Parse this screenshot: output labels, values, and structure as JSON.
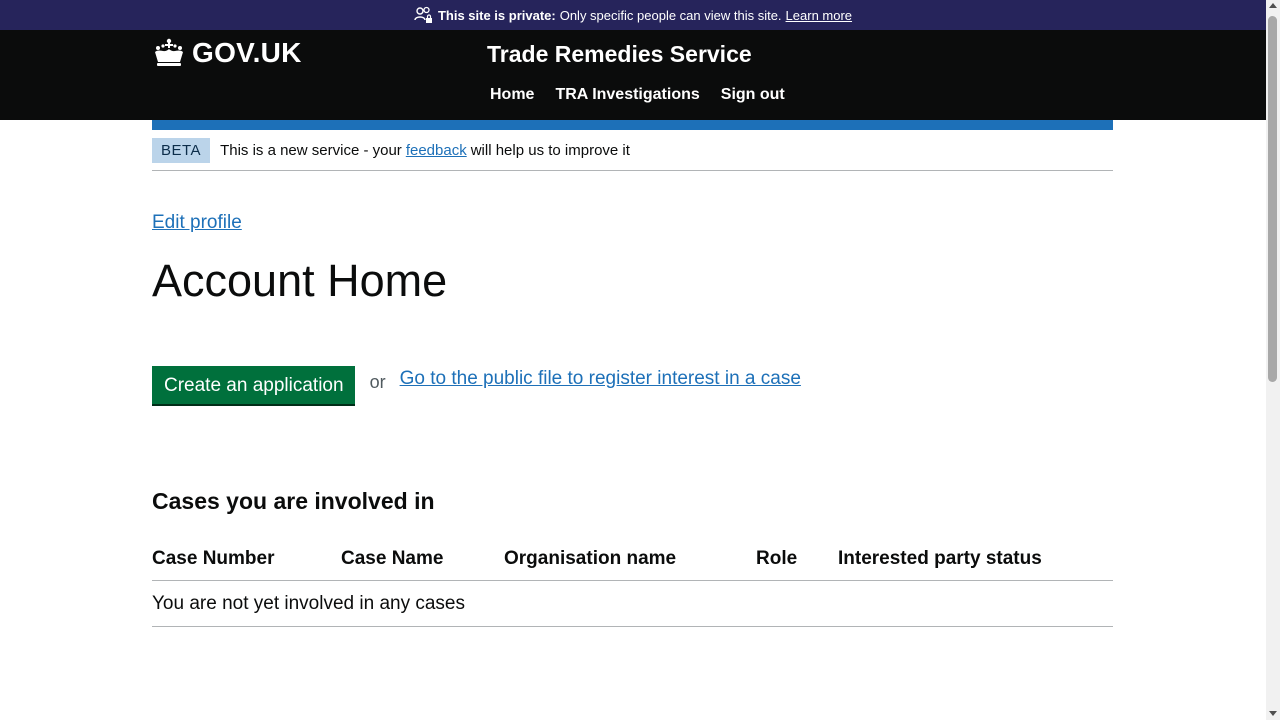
{
  "private_banner": {
    "bold": "This site is private:",
    "text": "Only specific people can view this site.",
    "link": "Learn more",
    "icon": "people-lock-icon"
  },
  "header": {
    "logo_text": "GOV.UK",
    "logo_icon": "crown-icon",
    "service_name": "Trade Remedies Service",
    "nav": [
      "Home",
      "TRA Investigations",
      "Sign out"
    ]
  },
  "beta_banner": {
    "tag": "BETA",
    "text_before": "This is a new service - your",
    "link": "feedback",
    "text_after": "will help us to improve it"
  },
  "main": {
    "edit_profile": "Edit profile",
    "title": "Account Home",
    "create_button": "Create an application",
    "or": "or",
    "public_file_link": "Go to the public file to register interest in a case",
    "cases_heading": "Cases you are involved in",
    "table": {
      "headers": [
        "Case Number",
        "Case Name",
        "Organisation name",
        "Role",
        "Interested party status"
      ],
      "empty_message": "You are not yet involved in any cases"
    }
  },
  "colors": {
    "private_bar": "#26245b",
    "header": "#0b0c0c",
    "accent_blue": "#1d70b8",
    "button_green": "#00703c",
    "beta_tag": "#bbd4ea"
  }
}
